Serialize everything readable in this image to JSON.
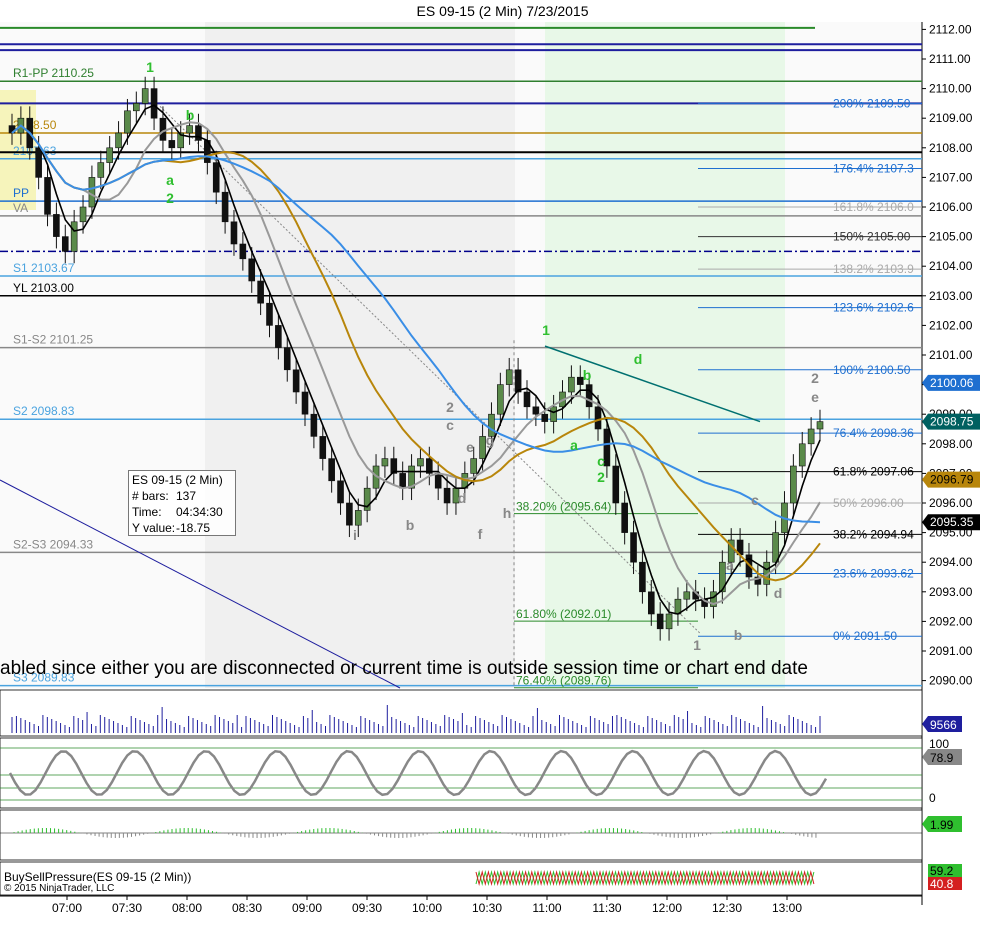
{
  "window": {
    "title": "ES 09-15 (2 Min)  7/23/2015"
  },
  "marquee": "abled since either you are disconnected or current time is outside session time or chart end date",
  "info_box": {
    "line1": "ES 09-15 (2 Min)",
    "bars_label": "# bars:",
    "bars_value": "137",
    "time_label": "Time:",
    "time_value": "04:34:30",
    "yval_label": "Y value:",
    "yval_value": "-18.75"
  },
  "footer": {
    "copyright": "© 2015 NinjaTrader, LLC",
    "indicator": "BuySellPressure(ES 09-15 (2 Min))"
  },
  "colors": {
    "up": "#4a7a3a",
    "down": "#111111",
    "sma_fast": "#000000",
    "sma_gray": "#999999",
    "sma_gold": "#b8860b",
    "sma_blue": "#3a8ee6",
    "pivot_blue": "#00008b",
    "session_gray": "#eeeeee",
    "session_green": "#e6f7e6"
  },
  "chart_data": {
    "type": "candlestick",
    "title": "ES 09-15 (2 Min)  7/23/2015",
    "xlabel": "",
    "ylabel": "",
    "ylim": [
      2089.75,
      2112.25
    ],
    "x_ticks": [
      "07:00",
      "07:30",
      "08:00",
      "08:30",
      "09:00",
      "09:30",
      "10:00",
      "10:30",
      "11:00",
      "11:30",
      "12:00",
      "12:30",
      "13:00"
    ],
    "y_ticks": [
      "2112.00",
      "2111.00",
      "2110.00",
      "2109.00",
      "2108.00",
      "2107.00",
      "2106.00",
      "2105.00",
      "2104.00",
      "2103.00",
      "2102.00",
      "2101.00",
      "2100.00",
      "2099.00",
      "2098.00",
      "2097.00",
      "2096.00",
      "2095.00",
      "2094.00",
      "2093.00",
      "2092.00",
      "2091.00",
      "2090.00"
    ],
    "price_markers": [
      {
        "label": "2100.06",
        "value": 2100.06,
        "color": "#1e6fd0",
        "text_color": "#ffffff"
      },
      {
        "label": "2098.75",
        "value": 2098.75,
        "color": "#006060",
        "text_color": "#ffffff"
      },
      {
        "label": "2096.79",
        "value": 2096.79,
        "color": "#b8860b",
        "text_color": "#000000"
      },
      {
        "label": "2095.35",
        "value": 2095.35,
        "color": "#000000",
        "text_color": "#ffffff"
      }
    ],
    "levels": [
      {
        "label": "R1-PP 2110.25",
        "value": 2110.25,
        "color": "#2f7f2f"
      },
      {
        "label": "2108.50",
        "value": 2108.5,
        "color": "#b8860b"
      },
      {
        "label": "2107.63",
        "value": 2107.63,
        "color": "#4aa3df"
      },
      {
        "label": "PP",
        "value": 2106.2,
        "color": "#1e6fd0"
      },
      {
        "label": "VA",
        "value": 2105.7,
        "color": "#888888"
      },
      {
        "label": "S1 2103.67",
        "value": 2103.67,
        "color": "#4aa3df"
      },
      {
        "label": "YL 2103.00",
        "value": 2103.0,
        "color": "#000000"
      },
      {
        "label": "S1-S2 2101.25",
        "value": 2101.25,
        "color": "#888888"
      },
      {
        "label": "S2 2098.83",
        "value": 2098.83,
        "color": "#4aa3df"
      },
      {
        "label": "S2-S3 2094.33",
        "value": 2094.33,
        "color": "#888888"
      },
      {
        "label": "S3 2089.83",
        "value": 2089.83,
        "color": "#4aa3df"
      }
    ],
    "fib_right": [
      {
        "label": "200%  2109.50",
        "value": 2109.5,
        "color": "#1e6fd0"
      },
      {
        "label": "176.4%  2107.3",
        "value": 2107.3,
        "color": "#1e6fd0"
      },
      {
        "label": "161.8%  2106.0",
        "value": 2106.0,
        "color": "#aaaaaa"
      },
      {
        "label": "150%  2105.00",
        "value": 2105.0,
        "color": "#333333"
      },
      {
        "label": "138.2%  2103.9",
        "value": 2103.9,
        "color": "#aaaaaa"
      },
      {
        "label": "123.6%  2102.6",
        "value": 2102.6,
        "color": "#1e6fd0"
      },
      {
        "label": "100%  2100.50",
        "value": 2100.5,
        "color": "#1e6fd0"
      },
      {
        "label": "76.4%  2098.36",
        "value": 2098.36,
        "color": "#1e6fd0"
      },
      {
        "label": "61.8%  2097.06",
        "value": 2097.06,
        "color": "#000000"
      },
      {
        "label": "50%  2096.00",
        "value": 2096.0,
        "color": "#aaaaaa"
      },
      {
        "label": "38.2%  2094.94",
        "value": 2094.94,
        "color": "#000000"
      },
      {
        "label": "23.6%  2093.62",
        "value": 2093.62,
        "color": "#1e6fd0"
      },
      {
        "label": "0%  2091.50",
        "value": 2091.5,
        "color": "#1e6fd0"
      }
    ],
    "fib_mid": [
      {
        "label": "38.20% (2095.64)",
        "value": 2095.64
      },
      {
        "label": "61.80% (2092.01)",
        "value": 2092.01
      },
      {
        "label": "76.40% (2089.76)",
        "value": 2089.76
      }
    ],
    "wave_labels": [
      {
        "text": "1",
        "color": "#2fbf2f"
      },
      {
        "text": "2",
        "color": "#888888"
      },
      {
        "text": "a",
        "color": "#2fbf2f"
      },
      {
        "text": "b",
        "color": "#2fbf2f"
      },
      {
        "text": "c",
        "color": "#2fbf2f"
      },
      {
        "text": "d",
        "color": "#2fbf2f"
      },
      {
        "text": "e",
        "color": "#888888"
      },
      {
        "text": "f",
        "color": "#888888"
      },
      {
        "text": "g",
        "color": "#888888"
      },
      {
        "text": "h",
        "color": "#888888"
      },
      {
        "text": "i",
        "color": "#888888"
      }
    ],
    "closes": [
      2108.5,
      2109.0,
      2108.0,
      2107.0,
      2105.75,
      2105.0,
      2104.5,
      2105.5,
      2106.0,
      2107.0,
      2107.5,
      2108.0,
      2108.5,
      2109.25,
      2109.5,
      2110.0,
      2109.0,
      2108.25,
      2108.0,
      2108.5,
      2108.75,
      2108.25,
      2107.5,
      2106.5,
      2105.5,
      2104.75,
      2104.25,
      2103.5,
      2102.75,
      2102.0,
      2101.25,
      2100.5,
      2099.75,
      2099.0,
      2098.25,
      2097.5,
      2096.75,
      2096.0,
      2095.25,
      2095.75,
      2096.5,
      2097.25,
      2097.5,
      2097.0,
      2096.5,
      2097.25,
      2097.5,
      2097.0,
      2096.5,
      2096.0,
      2096.5,
      2097.0,
      2097.5,
      2098.25,
      2099.0,
      2100.0,
      2100.5,
      2099.75,
      2099.25,
      2099.0,
      2098.75,
      2099.25,
      2099.75,
      2100.25,
      2100.0,
      2099.25,
      2098.5,
      2097.25,
      2096.0,
      2095.0,
      2094.0,
      2093.0,
      2092.25,
      2091.75,
      2092.25,
      2092.75,
      2093.0,
      2092.75,
      2092.5,
      2093.0,
      2094.0,
      2094.75,
      2094.25,
      2093.5,
      2093.25,
      2094.0,
      2095.0,
      2096.0,
      2097.25,
      2098.0,
      2098.5,
      2098.75
    ],
    "series": [
      {
        "name": "volume",
        "values": []
      },
      {
        "name": "BuySellPressure",
        "values": [
          "59.2",
          "40.8"
        ]
      }
    ],
    "panels": {
      "volume_label": "9566",
      "stoch_label": "78.9",
      "stoch_ticks": [
        "100",
        "0"
      ],
      "wave_label": "1.99",
      "bsp_buy": "59.2",
      "bsp_sell": "40.8"
    }
  }
}
